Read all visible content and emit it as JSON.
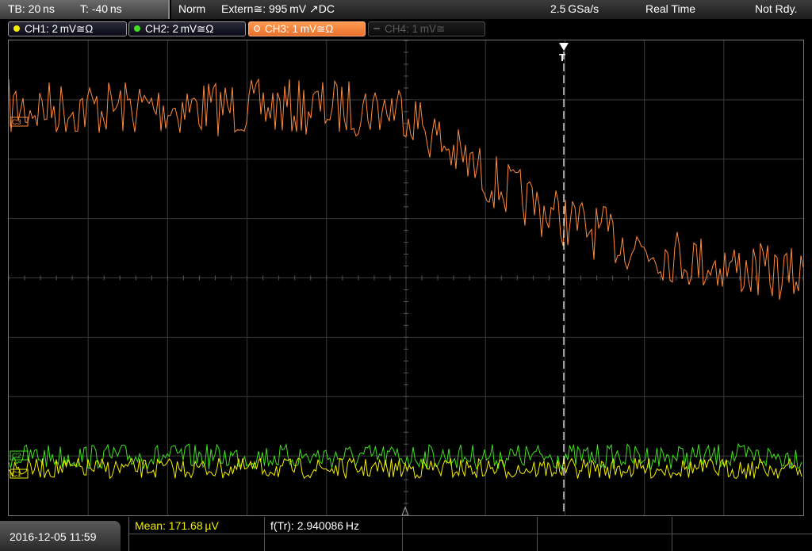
{
  "topbar": {
    "timebase": "TB: 20 ns",
    "trigger_time": "T: -40 ns",
    "mode": "Norm",
    "trigger_source": "Extern≅: 995 mV ↗DC",
    "sample_rate": "2.5 GSa/s",
    "acquisition": "Real Time",
    "status": "Not Rdy."
  },
  "channels": [
    {
      "label": "CH1: 2 mV≅Ω",
      "color": "#f4f000",
      "state": "on"
    },
    {
      "label": "CH2: 2 mV≅Ω",
      "color": "#40e020",
      "state": "on"
    },
    {
      "label": "CH3: 1 mV≅Ω",
      "color": "#ff8a3c",
      "state": "selected"
    },
    {
      "label": "CH4: 1 mV≅",
      "color": "#555555",
      "state": "off"
    }
  ],
  "markers": {
    "ch3": "C3",
    "ch2": "C2",
    "ch1": "C1",
    "trigger": "T"
  },
  "measurements": {
    "mean": "Mean: 171.68 µV",
    "frequency": "f(Tr): 2.940086 Hz"
  },
  "datetime": "2016-12-05 11:59",
  "colors": {
    "ch1": "#f4f000",
    "ch2": "#40e020",
    "ch3": "#ff8a3c",
    "grid": "#3a3a3a",
    "trigger_line": "#ffffff"
  }
}
